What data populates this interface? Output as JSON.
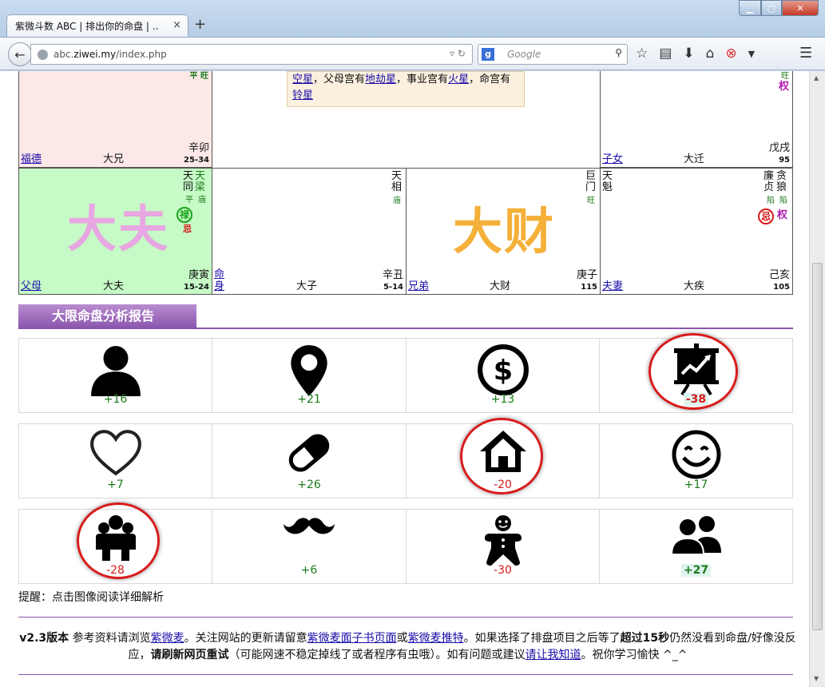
{
  "browser": {
    "tab_title": "紫微斗数 ABC | 排出你的命盘 | ...",
    "tab_close": "×",
    "new_tab": "+",
    "url_plain": "abc.",
    "url_domain": "ziwei.my",
    "url_path": "/index.php",
    "search_placeholder": "Google",
    "search_engine": "g"
  },
  "chart": {
    "top_left": {
      "stars_br": "平 旺",
      "bl": "福德",
      "bc": "大兄",
      "br": "辛卯",
      "range": "25-34"
    },
    "top_right": {
      "wang": "旺",
      "quan": "权",
      "bl": "子女",
      "bc": "大迁",
      "br": "戊戌",
      "range": "95"
    },
    "note_parts": [
      "空星",
      "，父母宫有",
      "地劫星",
      "，事业宫有",
      "火星",
      "，命宫有",
      "铃星"
    ],
    "c1": {
      "s1": "天",
      "s2": "天",
      "s3": "同",
      "s4": "梁",
      "b1": "平",
      "b2": "庙",
      "lu": "禄",
      "ji": "忌",
      "big": "大夫",
      "bl": "父母",
      "bc": "大夫",
      "br": "庚寅",
      "range": "15-24"
    },
    "c2": {
      "s1": "天",
      "s2": "相",
      "b1": "庙",
      "bl1": "命",
      "bl2": "身",
      "bc": "大子",
      "br": "辛丑",
      "range": "5-14"
    },
    "c3": {
      "s1": "巨",
      "s2": "门",
      "b1": "旺",
      "big": "大财",
      "bl": "兄弟",
      "bc": "大财",
      "br": "庚子",
      "range": "115"
    },
    "c4": {
      "l1": "天",
      "l2": "魁",
      "s1": "廉",
      "s2": "贪",
      "s3": "贞",
      "s4": "狼",
      "b1": "陷",
      "b2": "陷",
      "ji": "忌",
      "quan": "权",
      "bl": "夫妻",
      "bc": "大疾",
      "br": "己亥",
      "range": "105"
    }
  },
  "report": {
    "title": "大限命盘分析报告",
    "items": [
      {
        "icon": "person-icon",
        "score": "+16"
      },
      {
        "icon": "map-pin-icon",
        "score": "+21"
      },
      {
        "icon": "dollar-circle-icon",
        "score": "+13"
      },
      {
        "icon": "presentation-chart-icon",
        "score": "-38"
      },
      {
        "icon": "heart-icon",
        "score": "+7"
      },
      {
        "icon": "pill-icon",
        "score": "+26"
      },
      {
        "icon": "house-icon",
        "score": "-20"
      },
      {
        "icon": "smile-icon",
        "score": "+17"
      },
      {
        "icon": "group-icon",
        "score": "-28"
      },
      {
        "icon": "mustache-icon",
        "score": "+6"
      },
      {
        "icon": "gingerbread-icon",
        "score": "-30"
      },
      {
        "icon": "friends-icon",
        "score": "+27"
      }
    ],
    "tip": "提醒：点击图像阅读详细解析"
  },
  "footer": {
    "version": "v2.3版本",
    "t1": " 参考资料请浏览",
    "link1": "紫微麦",
    "t2": "。关注网站的更新请留意",
    "link2": "紫微麦面子书页面",
    "t3": "或",
    "link3": "紫微麦推特",
    "t4": "。如果选择了排盘项目之后等了",
    "bold1": "超过15秒",
    "t5": "仍然没看到命盘/好像没反应，",
    "bold2": "请刷新网页重试",
    "t6": "（可能网速不稳定掉线了或者程序有虫哦）。如有问题或建议",
    "link4": "请让我知道",
    "t7": "。祝你学习愉快 ^_^"
  },
  "colors": {
    "accent": "#8a55ad",
    "positive": "#1a7a1a",
    "negative": "#d61a1a",
    "big_pink": "#e8a6e2",
    "big_orange": "#f5b03a"
  }
}
